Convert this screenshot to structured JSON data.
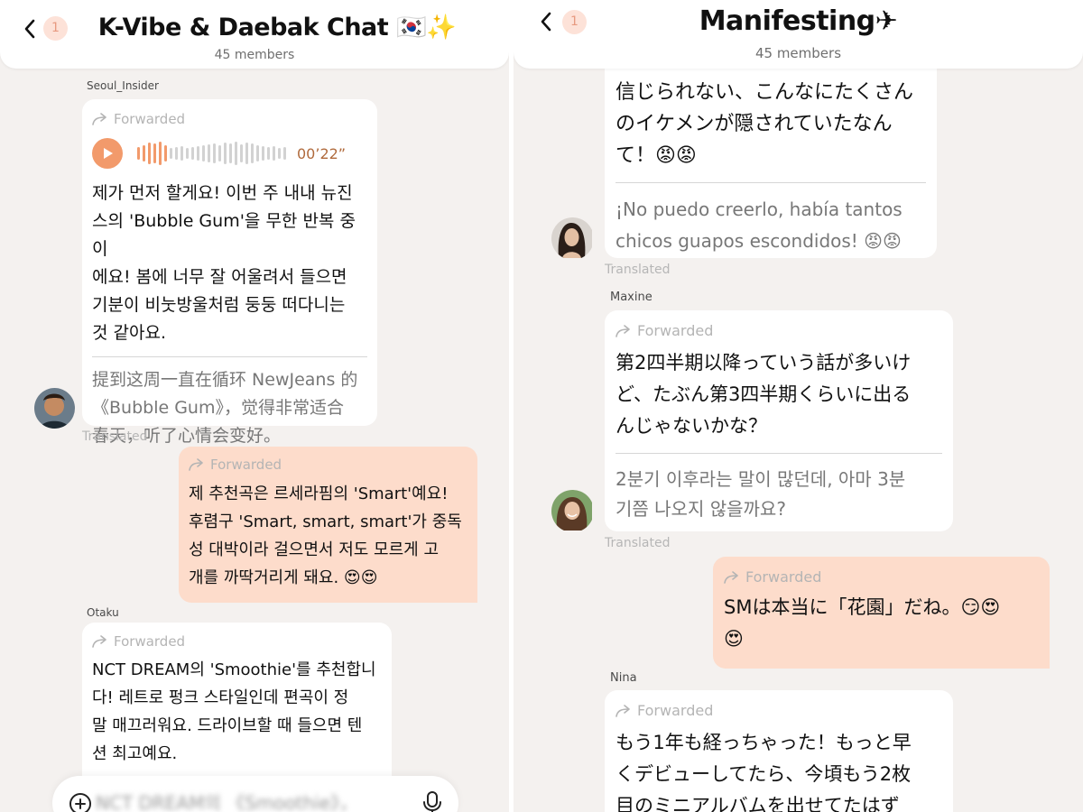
{
  "left": {
    "header": {
      "title": "K-Vibe & Daebak Chat 🇰🇷✨",
      "members": "45 members",
      "unread": "1"
    },
    "messages": {
      "m1": {
        "sender": "Seoul_Insider",
        "forwarded": "Forwarded",
        "duration": "00’22”",
        "text": [
          "제가 먼저 할게요! 이번 주 내내 뉴진",
          "스의 'Bubble Gum'을 무한 반복 중이",
          "에요! 봄에 너무 잘 어울려서 들으면",
          "기분이 비눗방울처럼 둥둥 떠다니는",
          "것 같아요."
        ],
        "translation": [
          "提到这周一直在循环 NewJeans 的",
          "《Bubble Gum》，觉得非常适合",
          "春天，听了心情会变好。"
        ],
        "translated_label": "Translated",
        "voice_progress": 0.3
      },
      "m2": {
        "forwarded": "Forwarded",
        "text": [
          "제 추천곡은 르세라핌의 'Smart'예요!",
          "후렴구 'Smart, smart, smart'가 중독",
          "성 대박이라 걸으면서 저도 모르게 고",
          "개를 까딱거리게 돼요. 😍😍"
        ]
      },
      "m3": {
        "sender": "Otaku",
        "forwarded": "Forwarded",
        "text": [
          "NCT DREAM의 'Smoothie'를 추천합니",
          "다! 레트로 펑크 스타일인데 편곡이 정",
          "말 매끄러워요. 드라이브할 때 들으면 텐",
          "션 최고예요."
        ]
      }
    },
    "input": {
      "draft": "NCT DREAM의 《Smoothie》，"
    },
    "icons": {
      "back": "chevron-left-icon",
      "add": "plus-circle-icon",
      "mic": "microphone-icon",
      "play": "play-icon",
      "forward": "forward-arrow-icon"
    }
  },
  "right": {
    "header": {
      "title": "Manifesting✈",
      "members": "45 members",
      "unread": "1"
    },
    "messages": {
      "m1": {
        "text": [
          "信じられない、こんなにたくさん",
          "のイケメンが隠されていたなん",
          "て！😡😡"
        ],
        "translation": [
          "¡No puedo creerlo, había tantos",
          "chicos guapos escondidos! 😡😡"
        ],
        "translated_label": "Translated"
      },
      "m2": {
        "sender": "Maxine",
        "forwarded": "Forwarded",
        "text": [
          "第2四半期以降っていう話が多いけ",
          "ど、たぶん第3四半期くらいに出る",
          "んじゃないかな？"
        ],
        "translation": [
          "2분기 이후라는 말이 많던데, 아마 3분",
          "기쯤 나오지 않을까요?"
        ],
        "translated_label": "Translated"
      },
      "m3": {
        "forwarded": "Forwarded",
        "text": [
          "SMは本当に「花園」だね。😏😍",
          "😍"
        ]
      },
      "m4": {
        "sender": "Nina",
        "forwarded": "Forwarded",
        "text": [
          "もう1年も経っちゃった！もっと早",
          "くデビューしてたら、今頃もう2枚",
          "目のミニアルバムを出せてたはず"
        ]
      }
    }
  },
  "colors": {
    "background": "#f4f1ef",
    "my_bubble": "#fddccb",
    "accent": "#f29a6b",
    "unread_badge": "#fde2d8"
  }
}
